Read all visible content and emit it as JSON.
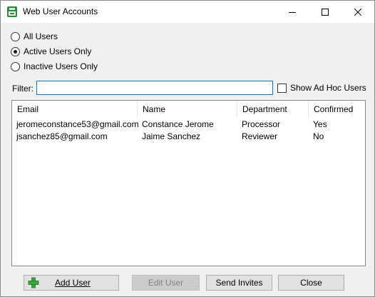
{
  "window": {
    "title": "Web User Accounts"
  },
  "user_filter": {
    "options": [
      {
        "label": "All Users",
        "checked": false
      },
      {
        "label": "Active Users Only",
        "checked": true
      },
      {
        "label": "Inactive Users Only",
        "checked": false
      }
    ]
  },
  "filter": {
    "label": "Filter:",
    "value": ""
  },
  "show_ad_hoc": {
    "label": "Show Ad Hoc Users",
    "checked": false
  },
  "table": {
    "columns": [
      "Email",
      "Name",
      "Department",
      "Confirmed"
    ],
    "rows": [
      [
        "jeromeconstance53@gmail.com",
        "Constance Jerome",
        "Processor",
        "Yes"
      ],
      [
        "jsanchez85@gmail.com",
        "Jaime Sanchez",
        "Reviewer",
        "No"
      ]
    ]
  },
  "buttons": {
    "add_user": "Add User",
    "edit_user": "Edit User",
    "send_invites": "Send Invites",
    "close": "Close"
  },
  "colors": {
    "accent": "#0078d7",
    "plus_icon": "#3aa53a"
  }
}
